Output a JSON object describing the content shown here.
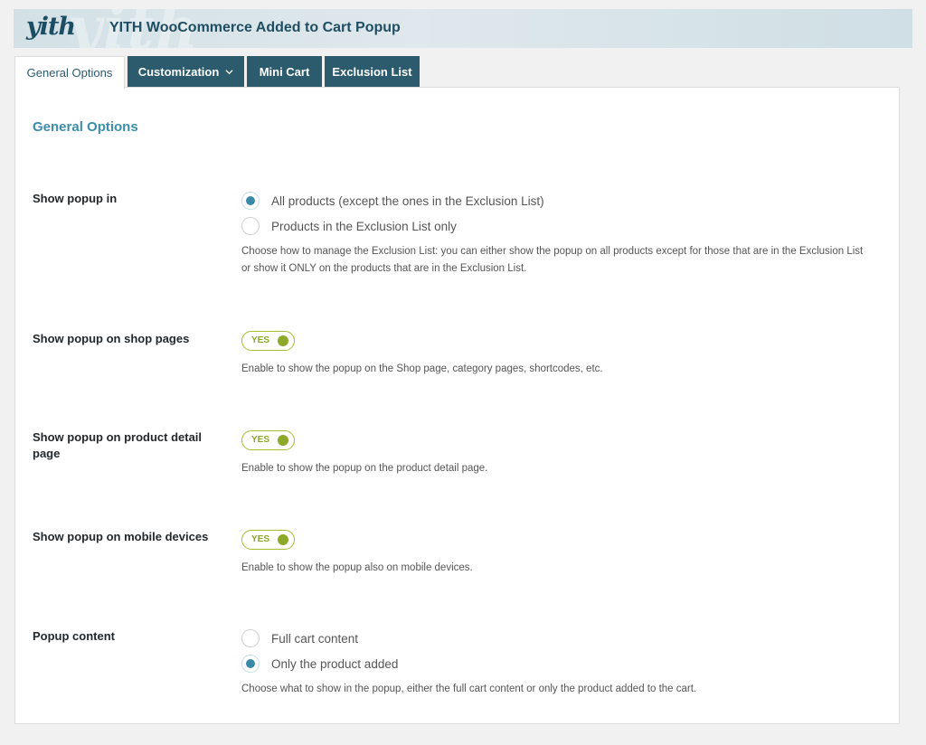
{
  "header": {
    "logo": "yith",
    "title": "YITH WooCommerce Added to Cart Popup"
  },
  "tabs": [
    {
      "label": "General Options",
      "active": true
    },
    {
      "label": "Customization",
      "active": false,
      "has_dropdown": true,
      "icon": "chevron-down-icon"
    },
    {
      "label": "Mini Cart",
      "active": false
    },
    {
      "label": "Exclusion List",
      "active": false
    }
  ],
  "section": {
    "title": "General Options"
  },
  "options": {
    "show_popup_in": {
      "label": "Show popup in",
      "choices": [
        {
          "label": "All products (except the ones in the Exclusion List)",
          "checked": true
        },
        {
          "label": "Products in the Exclusion List only",
          "checked": false
        }
      ],
      "description": "Choose how to manage the Exclusion List: you can either show the popup on all products except for those that are in the Exclusion List or show it ONLY on the products that are in the Exclusion List."
    },
    "shop_pages": {
      "label": "Show popup on shop pages",
      "toggle": "YES",
      "enabled": true,
      "description": "Enable to show the popup on the Shop page, category pages, shortcodes, etc."
    },
    "product_detail": {
      "label": "Show popup on product detail page",
      "toggle": "YES",
      "enabled": true,
      "description": "Enable to show the popup on the product detail page."
    },
    "mobile": {
      "label": "Show popup on mobile devices",
      "toggle": "YES",
      "enabled": true,
      "description": "Enable to show the popup also on mobile devices."
    },
    "popup_content": {
      "label": "Popup content",
      "choices": [
        {
          "label": "Full cart content",
          "checked": false
        },
        {
          "label": "Only the product added",
          "checked": true
        }
      ],
      "description": "Choose what to show in the popup, either the full cart content or only the product added to the cart."
    }
  },
  "colors": {
    "tab_bg": "#2b5b6d",
    "accent": "#3b8dab",
    "toggle_green": "#8ea82a"
  }
}
